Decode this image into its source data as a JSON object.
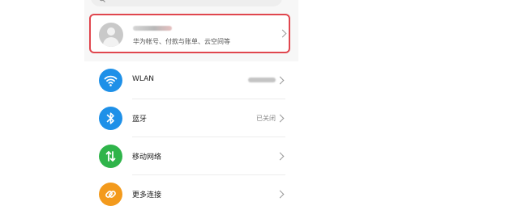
{
  "account": {
    "subtitle": "华为帐号、付款与账单、云空间等",
    "highlight_color": "#e0464e"
  },
  "settings": {
    "wlan": {
      "label": "WLAN",
      "icon": "wifi-icon",
      "color": "#1e90e8"
    },
    "bluetooth": {
      "label": "蓝牙",
      "value": "已关闭",
      "icon": "bluetooth-icon",
      "color": "#1e90e8"
    },
    "mobile_network": {
      "label": "移动网络",
      "icon": "mobile-data-icon",
      "color": "#2fb44a"
    },
    "more_connections": {
      "label": "更多连接",
      "icon": "link-icon",
      "color": "#f39a1c"
    }
  }
}
